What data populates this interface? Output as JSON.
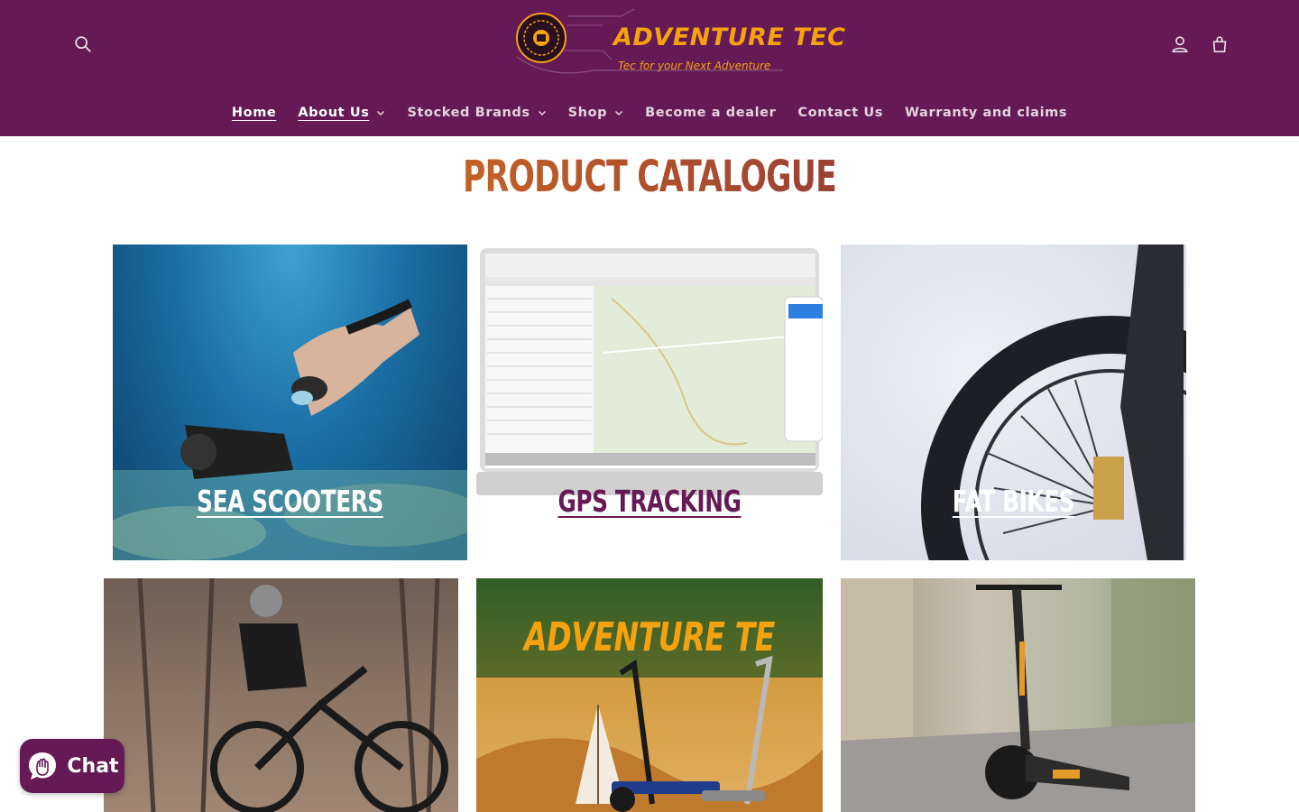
{
  "header": {
    "logo_text": "ADVENTURE TEC",
    "logo_tagline": "Tec for your Next Adventure",
    "search_icon": "search-icon",
    "account_icon": "account-icon",
    "cart_icon": "cart-icon",
    "colors": {
      "background": "#651a55",
      "logo": "#f5a20f",
      "nav_text": "#e4d3df"
    }
  },
  "nav": {
    "items": [
      {
        "label": "Home",
        "active": true,
        "dropdown": false
      },
      {
        "label": "About Us",
        "active": true,
        "dropdown": true
      },
      {
        "label": "Stocked Brands",
        "active": false,
        "dropdown": true
      },
      {
        "label": "Shop",
        "active": false,
        "dropdown": true
      },
      {
        "label": "Become a dealer",
        "active": false,
        "dropdown": false
      },
      {
        "label": "Contact Us",
        "active": false,
        "dropdown": false
      },
      {
        "label": "Warranty and claims",
        "active": false,
        "dropdown": false
      }
    ]
  },
  "main": {
    "title": "PRODUCT CATALOGUE",
    "tiles": [
      {
        "label": "SEA SCOOTERS",
        "label_color": "#ffffff"
      },
      {
        "label": "GPS TRACKING",
        "label_color": "#651a55"
      },
      {
        "label": "FAT BIKES",
        "label_color": "#ffffff"
      },
      {
        "label": "",
        "label_color": "#ffffff"
      },
      {
        "label": "ADVENTURE TE",
        "label_color": "#f5a20f"
      },
      {
        "label": "",
        "label_color": "#ffffff"
      }
    ]
  },
  "chat": {
    "label": "Chat",
    "icon": "chat-bubble-icon"
  }
}
